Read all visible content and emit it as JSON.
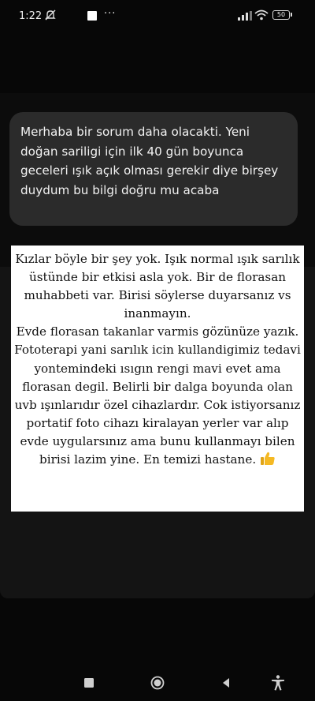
{
  "status_bar": {
    "time": "1:22",
    "battery": "50",
    "more": "···"
  },
  "question": {
    "text": "Merhaba bir sorum daha olacakti. Yeni doğan sariligi için ilk 40 gün boyunca geceleri ışık açık olması gerekir diye birşey duydum bu bilgi doğru mu acaba"
  },
  "answer": {
    "text": "Kızlar böyle bir şey yok. Işık normal ışık sarılık üstünde bir etkisi asla yok. Bir de florasan muhabbeti var. Birisi söylerse duyarsanız vs inanmayın.\nEvde florasan takanlar varmis gözünüze yazık.\nFototerapi yani sarılık icin kullandigimiz tedavi yontemindeki ısıgın rengi mavi evet ama florasan degil. Belirli bir dalga boyunda olan uvb ışınlarıdır özel cihazlardır. Cok istiyorsanız portatif foto cihazı kiralayan yerler var alıp evde uygularsınız ama bunu kullanmayı bilen birisi lazim yine. En temizi hastane.",
    "emoji": "thumbs-up-icon"
  },
  "colors": {
    "background": "#070707",
    "bubble": "#2b2b2b",
    "answer_bg": "#ffffff",
    "thumb": "#f5b923"
  }
}
